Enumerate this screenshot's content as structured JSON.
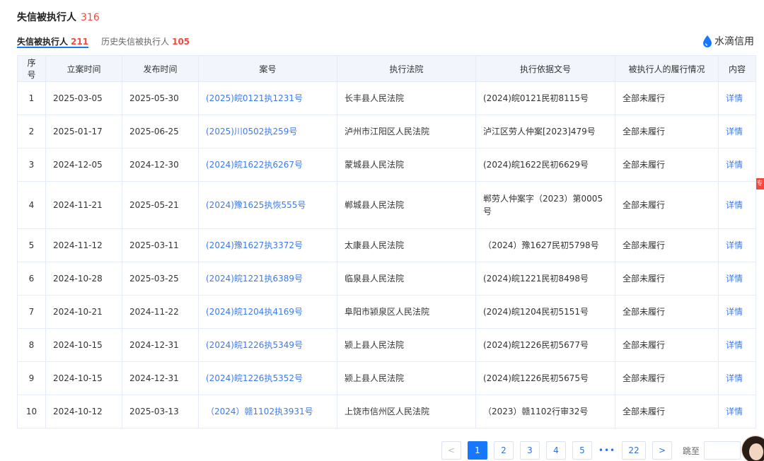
{
  "section": {
    "title": "失信被执行人",
    "count": "316"
  },
  "tabs": [
    {
      "label": "失信被执行人",
      "count": "211"
    },
    {
      "label": "历史失信被执行人",
      "count": "105"
    }
  ],
  "brand": {
    "name": "水滴信用",
    "color": "#1677ff"
  },
  "side_tag": "专",
  "table": {
    "headers": [
      "序号",
      "立案时间",
      "发布时间",
      "案号",
      "执行法院",
      "执行依据文号",
      "被执行人的履行情况",
      "内容"
    ],
    "rows": [
      [
        "1",
        "2025-03-05",
        "2025-05-30",
        "(2025)皖0121执1231号",
        "长丰县人民法院",
        "(2024)皖0121民初8115号",
        "全部未履行",
        "详情"
      ],
      [
        "2",
        "2025-01-17",
        "2025-06-25",
        "(2025)川0502执259号",
        "泸州市江阳区人民法院",
        "泸江区劳人仲案[2023]479号",
        "全部未履行",
        "详情"
      ],
      [
        "3",
        "2024-12-05",
        "2024-12-30",
        "(2024)皖1622执6267号",
        "蒙城县人民法院",
        "(2024)皖1622民初6629号",
        "全部未履行",
        "详情"
      ],
      [
        "4",
        "2024-11-21",
        "2025-05-21",
        "(2024)豫1625执恢555号",
        "郸城县人民法院",
        "郸劳人仲案字（2023）第0005号",
        "全部未履行",
        "详情"
      ],
      [
        "5",
        "2024-11-12",
        "2025-03-11",
        "(2024)豫1627执3372号",
        "太康县人民法院",
        "（2024）豫1627民初5798号",
        "全部未履行",
        "详情"
      ],
      [
        "6",
        "2024-10-28",
        "2025-03-25",
        "(2024)皖1221执6389号",
        "临泉县人民法院",
        "(2024)皖1221民初8498号",
        "全部未履行",
        "详情"
      ],
      [
        "7",
        "2024-10-21",
        "2024-11-22",
        "(2024)皖1204执4169号",
        "阜阳市颍泉区人民法院",
        "(2024)皖1204民初5151号",
        "全部未履行",
        "详情"
      ],
      [
        "8",
        "2024-10-15",
        "2024-12-31",
        "(2024)皖1226执5349号",
        "颍上县人民法院",
        "(2024)皖1226民初5677号",
        "全部未履行",
        "详情"
      ],
      [
        "9",
        "2024-10-15",
        "2024-12-31",
        "(2024)皖1226执5352号",
        "颍上县人民法院",
        "(2024)皖1226民初5675号",
        "全部未履行",
        "详情"
      ],
      [
        "10",
        "2024-10-12",
        "2025-03-13",
        "（2024）赣1102执3931号",
        "上饶市信州区人民法院",
        "（2023）赣1102行审32号",
        "全部未履行",
        "详情"
      ]
    ]
  },
  "pagination": {
    "prev": "<",
    "pages": [
      "1",
      "2",
      "3",
      "4",
      "5"
    ],
    "ellipsis": "•••",
    "last": "22",
    "next": ">",
    "jump_label": "跳至",
    "current": 1
  }
}
